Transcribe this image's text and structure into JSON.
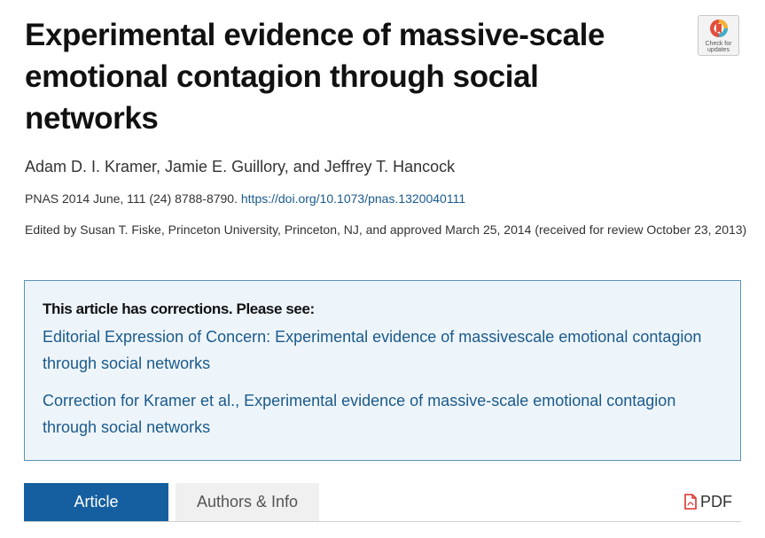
{
  "article": {
    "title": "Experimental evidence of massive-scale emotional contagion through social networks",
    "authors": "Adam D. I. Kramer, Jamie E. Guillory, and Jeffrey T. Hancock",
    "citation": "PNAS 2014 June, 111 (24) 8788-8790.",
    "doi": "https://doi.org/10.1073/pnas.1320040111",
    "edited_by": "Edited by Susan T. Fiske, Princeton University, Princeton, NJ, and approved March 25, 2014 (received for review October 23, 2013)"
  },
  "check_for_updates": {
    "label": "Check for updates",
    "icon": "crossmark-icon"
  },
  "corrections": {
    "heading": "This article has corrections. Please see:",
    "links": [
      "Editorial Expression of Concern: Experimental evidence of massivescale emotional contagion through social networks",
      "Correction for Kramer et al., Experimental evidence of massive-scale emotional contagion through social networks"
    ]
  },
  "tabs": {
    "article": "Article",
    "authors_info": "Authors & Info",
    "active": "Article"
  },
  "pdf": {
    "label": "PDF",
    "icon": "pdf-file-icon"
  },
  "colors": {
    "link": "#1a5a8c",
    "active_tab": "#155fa0",
    "corrections_bg": "#eef5fa",
    "corrections_border": "#5a93b8",
    "pdf_icon": "#d9342b"
  }
}
